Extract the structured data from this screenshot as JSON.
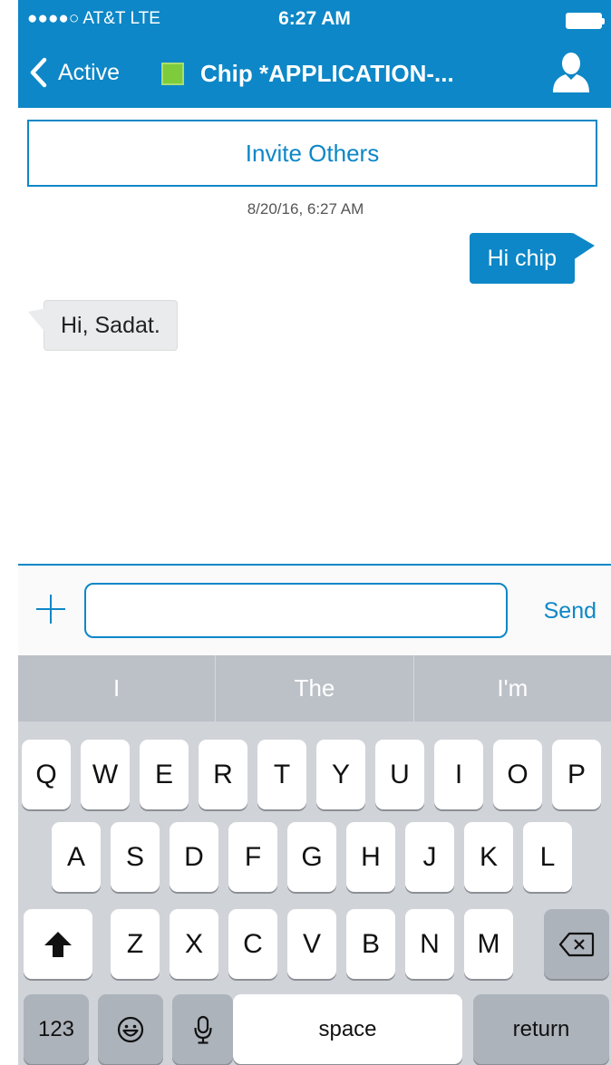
{
  "status_bar": {
    "signal": "●●●●○",
    "carrier": "AT&T  LTE",
    "time": "6:27 AM"
  },
  "nav": {
    "back_label": "Active",
    "title": "Chip *APPLICATION-...",
    "presence_color": "#7ecb3b"
  },
  "invite_label": "Invite Others",
  "timestamp": "8/20/16, 6:27 AM",
  "messages": [
    {
      "direction": "outgoing",
      "text": "Hi chip"
    },
    {
      "direction": "incoming",
      "text": "Hi, Sadat."
    }
  ],
  "composer": {
    "input_value": "",
    "send_label": "Send"
  },
  "keyboard": {
    "suggestions": [
      "I",
      "The",
      "I'm"
    ],
    "row1": [
      "Q",
      "W",
      "E",
      "R",
      "T",
      "Y",
      "U",
      "I",
      "O",
      "P"
    ],
    "row2": [
      "A",
      "S",
      "D",
      "F",
      "G",
      "H",
      "J",
      "K",
      "L"
    ],
    "row3": [
      "Z",
      "X",
      "C",
      "V",
      "B",
      "N",
      "M"
    ],
    "numbers_label": "123",
    "space_label": "space",
    "return_label": "return"
  },
  "colors": {
    "accent": "#0d87c7",
    "keyboard_bg": "#d0d3d8"
  }
}
